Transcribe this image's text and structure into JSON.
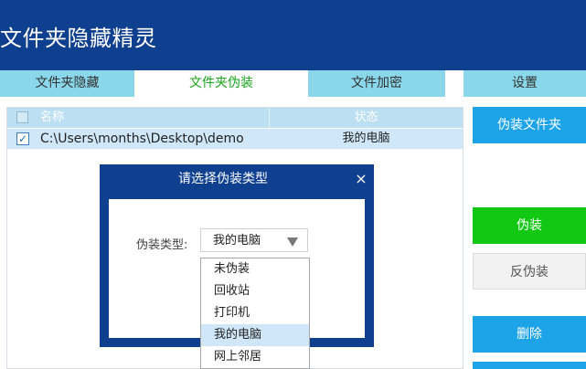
{
  "app": {
    "title": "文件夹隐藏精灵"
  },
  "tabs": [
    {
      "label": "文件夹隐藏"
    },
    {
      "label": "文件夹伪装",
      "active": true
    },
    {
      "label": "文件加密"
    },
    {
      "label": "设置"
    }
  ],
  "table": {
    "columns": {
      "name": "名称",
      "status": "状态"
    },
    "rows": [
      {
        "checked": true,
        "path": "C:\\Users\\months\\Desktop\\demo",
        "status": "我的电脑"
      }
    ]
  },
  "check_glyph": "✓",
  "actions": {
    "disguise_folder": "伪装文件夹",
    "disguise": "伪装",
    "undisguise": "反伪装",
    "delete": "删除"
  },
  "dialog": {
    "title": "请选择伪装类型",
    "close_glyph": "×",
    "type_label": "伪装类型:",
    "selected_value": "我的电脑",
    "options": [
      "未伪装",
      "回收站",
      "打印机",
      "我的电脑",
      "网上邻居"
    ],
    "highlighted_option": "我的电脑"
  },
  "colors": {
    "header_blue": "#0f3f8f",
    "tab_inactive": "#8ad6ea",
    "tab_active_text": "#1aa31a",
    "button_blue": "#1ca3e8",
    "button_green": "#12c812"
  }
}
